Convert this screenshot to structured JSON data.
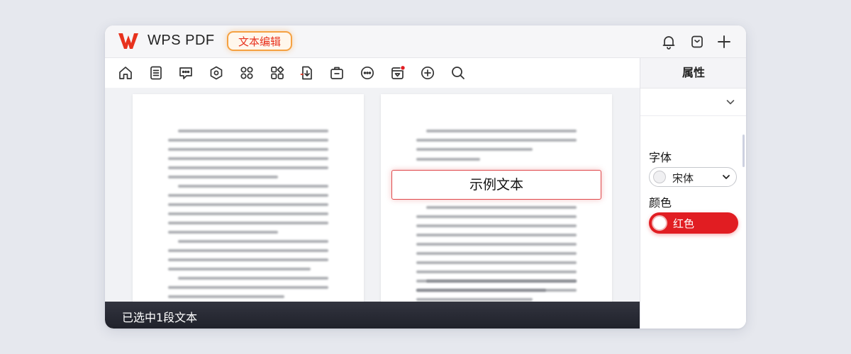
{
  "app": {
    "name": "WPS PDF",
    "mode_badge": "文本编辑",
    "brand_color": "#e8321e"
  },
  "titlebar_icons": [
    "bell-icon",
    "clipboard-icon",
    "plus-icon"
  ],
  "toolbar": {
    "tools": [
      "home-icon",
      "document-icon",
      "comment-icon",
      "shape-icon",
      "grid-icon",
      "apps-icon",
      "export-icon",
      "briefcase-icon",
      "chat-icon",
      "calendar-icon",
      "add-circle-icon",
      "search-icon"
    ],
    "notification_tool": "calendar-icon"
  },
  "document": {
    "selected_text": "示例文本"
  },
  "properties": {
    "title": "属性",
    "font_label": "字体",
    "font_value": "宋体",
    "color_label": "颜色",
    "color_value": "红色",
    "color_hex": "#e11d22"
  },
  "status": {
    "text": "已选中1段文本"
  }
}
